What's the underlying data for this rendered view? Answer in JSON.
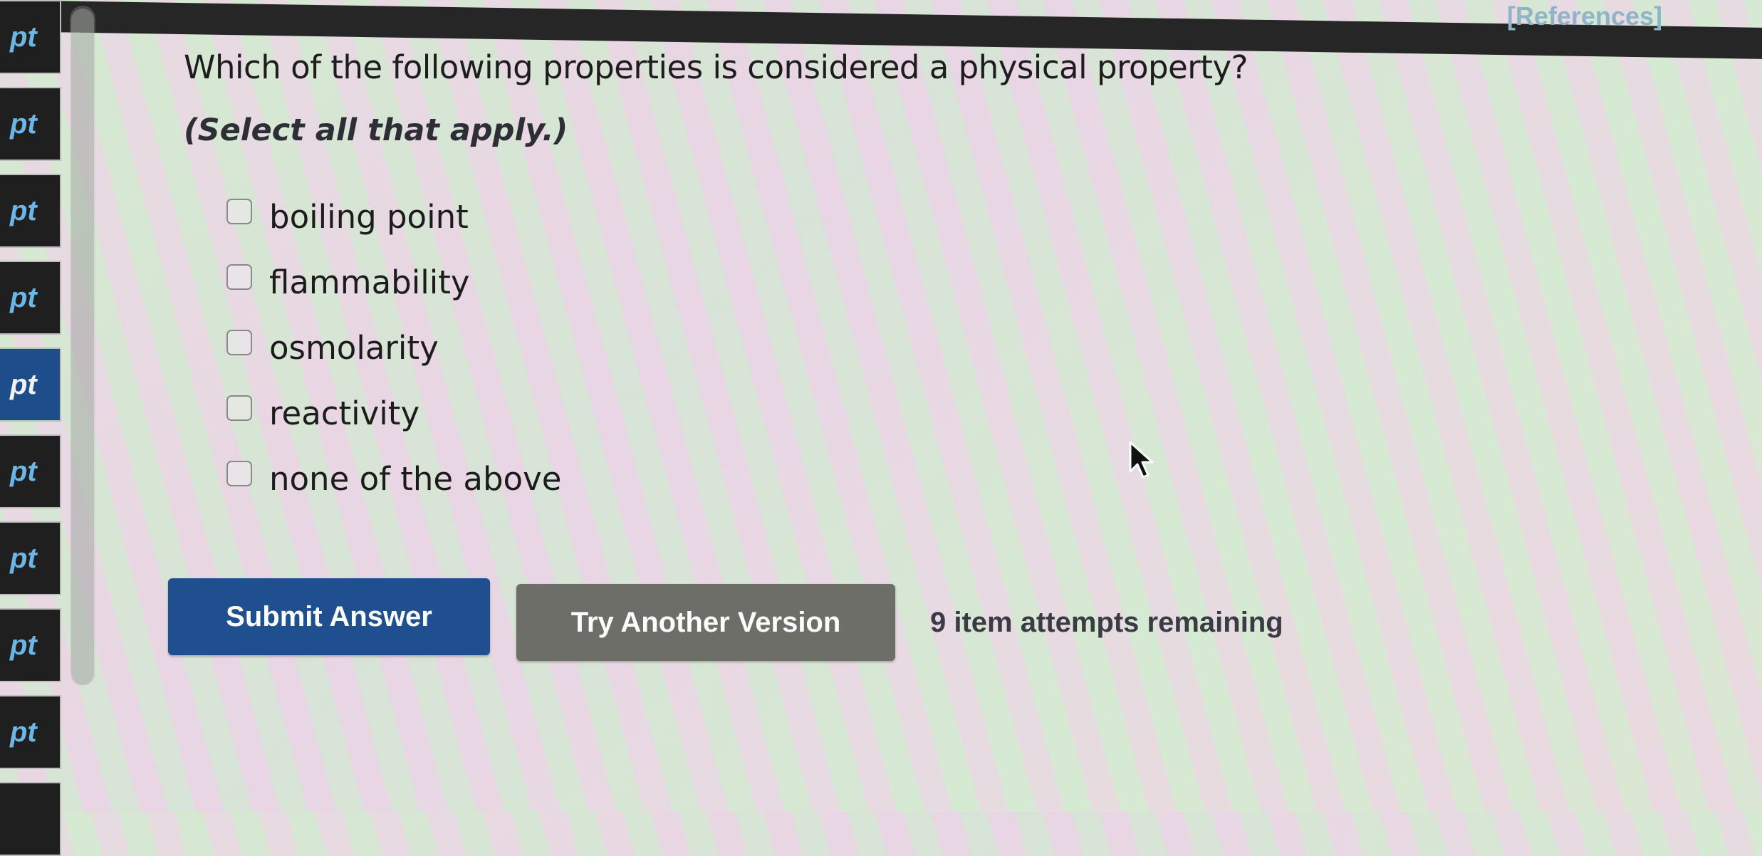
{
  "header": {
    "references_label": "[References]"
  },
  "sidebar": {
    "items": [
      {
        "label": "pt",
        "active": false
      },
      {
        "label": "pt",
        "active": false
      },
      {
        "label": "pt",
        "active": false
      },
      {
        "label": "pt",
        "active": false
      },
      {
        "label": "pt",
        "active": true
      },
      {
        "label": "pt",
        "active": false
      },
      {
        "label": "pt",
        "active": false
      },
      {
        "label": "pt",
        "active": false
      },
      {
        "label": "pt",
        "active": false
      }
    ]
  },
  "question": {
    "text": "Which of the following properties is considered a physical property?",
    "instruction": "(Select all that apply.)",
    "options": [
      {
        "label": "boiling point",
        "checked": false
      },
      {
        "label": "flammability",
        "checked": false
      },
      {
        "label": "osmolarity",
        "checked": false
      },
      {
        "label": "reactivity",
        "checked": false
      },
      {
        "label": "none of the above",
        "checked": false
      }
    ]
  },
  "actions": {
    "submit_label": "Submit Answer",
    "try_another_label": "Try Another Version",
    "attempts_text": "9 item attempts remaining"
  },
  "colors": {
    "submit_bg": "#1f4f8f",
    "try_bg": "#6d6e68",
    "active_tile_bg": "#1d4d8a",
    "tile_bg": "#1e1f1e",
    "tile_text": "#6cb6e6"
  }
}
